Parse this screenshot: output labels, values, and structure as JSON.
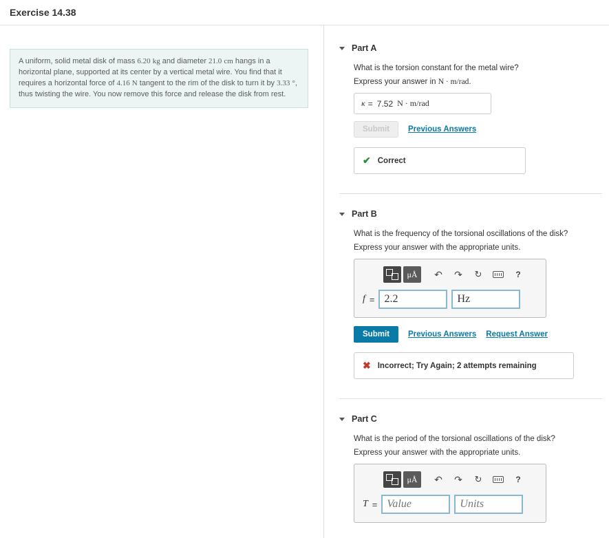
{
  "header": {
    "title": "Exercise 14.38"
  },
  "problem": {
    "text_1": "A uniform, solid metal disk of mass ",
    "mass": "6.20",
    "mass_unit": "kg",
    "text_2": " and diameter ",
    "diameter": "21.0",
    "diameter_unit": "cm",
    "text_3": " hangs in a horizontal plane, supported at its center by a vertical metal wire. You find that it requires a horizontal force of ",
    "force": "4.16",
    "force_unit": "N",
    "text_4": " tangent to the rim of the disk to turn it by ",
    "angle": "3.33",
    "angle_unit": "°",
    "text_5": ", thus twisting the wire. You now remove this force and release the disk from rest."
  },
  "links": {
    "submit": "Submit",
    "previous": "Previous Answers",
    "request": "Request Answer"
  },
  "toolbar": {
    "mu": "μÅ"
  },
  "partA": {
    "title": "Part A",
    "question": "What is the torsion constant for the metal wire?",
    "instruction_prefix": "Express your answer in ",
    "instruction_unit": "N · m/rad",
    "instruction_suffix": ".",
    "var": "κ",
    "eq": "=",
    "value": "7.52",
    "unit": "N · m/rad",
    "feedback": "Correct"
  },
  "partB": {
    "title": "Part B",
    "question": "What is the frequency of the torsional oscillations of the disk?",
    "instruction": "Express your answer with the appropriate units.",
    "var": "f",
    "eq": "=",
    "value": "2.2",
    "unit": "Hz",
    "feedback": "Incorrect; Try Again; 2 attempts remaining"
  },
  "partC": {
    "title": "Part C",
    "question": "What is the period of the torsional oscillations of the disk?",
    "instruction": "Express your answer with the appropriate units.",
    "var": "T",
    "eq": "=",
    "value_placeholder": "Value",
    "unit_placeholder": "Units"
  }
}
